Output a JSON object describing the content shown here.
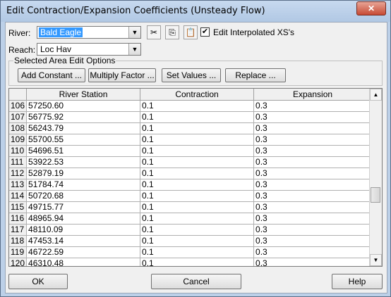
{
  "window": {
    "title": "Edit Contraction/Expansion Coefficients (Unsteady Flow)"
  },
  "river": {
    "label": "River:",
    "value": "Bald Eagle"
  },
  "reach": {
    "label": "Reach:",
    "value": "Loc Hav"
  },
  "toolbar": {
    "cut_icon": "scissors-icon",
    "copy_icon": "copy-icon",
    "paste_icon": "paste-icon",
    "edit_interpolated_label": "Edit Interpolated XS's",
    "edit_interpolated_checked": true
  },
  "area_edit": {
    "title": "Selected Area Edit Options",
    "add_constant": "Add Constant ...",
    "multiply_factor": "Multiply Factor ...",
    "set_values": "Set Values ...",
    "replace": "Replace ..."
  },
  "table": {
    "headers": [
      "River Station",
      "Contraction",
      "Expansion"
    ],
    "rows": [
      {
        "n": "106",
        "station": "57250.60",
        "contraction": "0.1",
        "expansion": "0.3"
      },
      {
        "n": "107",
        "station": "56775.92",
        "contraction": "0.1",
        "expansion": "0.3"
      },
      {
        "n": "108",
        "station": "56243.79",
        "contraction": "0.1",
        "expansion": "0.3"
      },
      {
        "n": "109",
        "station": "55700.55",
        "contraction": "0.1",
        "expansion": "0.3"
      },
      {
        "n": "110",
        "station": "54696.51",
        "contraction": "0.1",
        "expansion": "0.3"
      },
      {
        "n": "111",
        "station": "53922.53",
        "contraction": "0.1",
        "expansion": "0.3"
      },
      {
        "n": "112",
        "station": "52879.19",
        "contraction": "0.1",
        "expansion": "0.3"
      },
      {
        "n": "113",
        "station": "51784.74",
        "contraction": "0.1",
        "expansion": "0.3"
      },
      {
        "n": "114",
        "station": "50720.68",
        "contraction": "0.1",
        "expansion": "0.3"
      },
      {
        "n": "115",
        "station": "49715.77",
        "contraction": "0.1",
        "expansion": "0.3"
      },
      {
        "n": "116",
        "station": "48965.94",
        "contraction": "0.1",
        "expansion": "0.3"
      },
      {
        "n": "117",
        "station": "48110.09",
        "contraction": "0.1",
        "expansion": "0.3"
      },
      {
        "n": "118",
        "station": "47453.14",
        "contraction": "0.1",
        "expansion": "0.3"
      },
      {
        "n": "119",
        "station": "46722.59",
        "contraction": "0.1",
        "expansion": "0.3"
      },
      {
        "n": "120",
        "station": "46310.48",
        "contraction": "0.1",
        "expansion": "0.3"
      }
    ]
  },
  "buttons": {
    "ok": "OK",
    "cancel": "Cancel",
    "help": "Help"
  }
}
